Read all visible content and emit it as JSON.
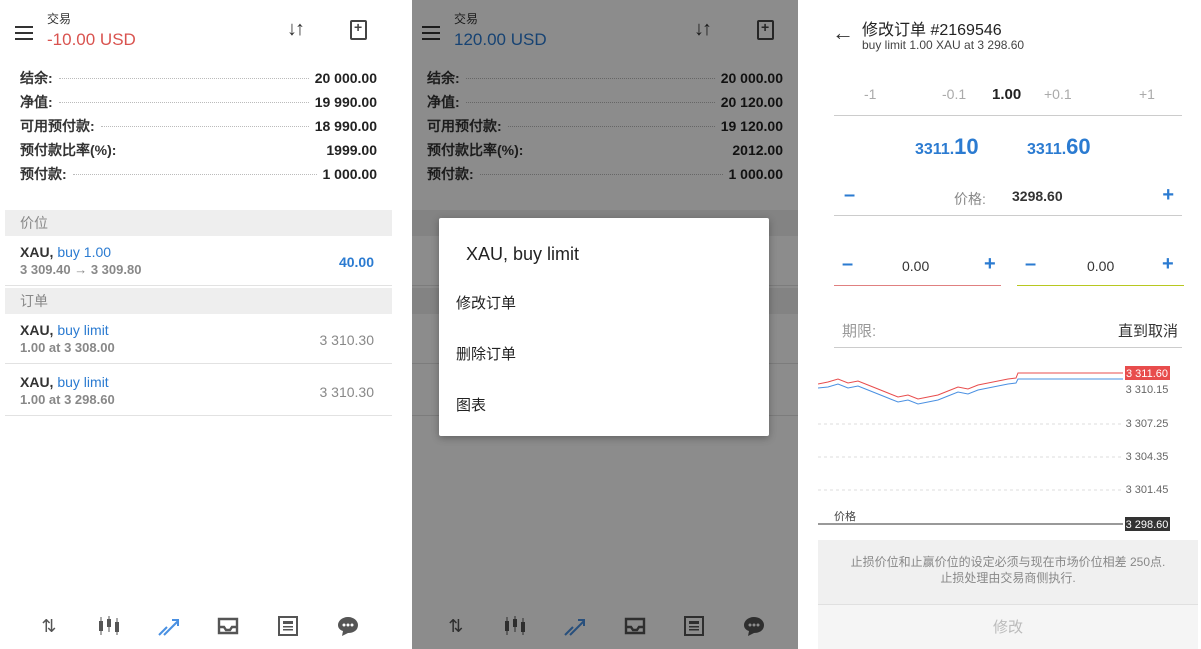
{
  "screens": [
    {
      "header": {
        "title": "交易",
        "balance": "-10.00 USD",
        "balance_color": "#d9534f"
      },
      "summary": [
        {
          "label": "结余:",
          "value": "20 000.00"
        },
        {
          "label": "净值:",
          "value": "19 990.00"
        },
        {
          "label": "可用预付款:",
          "value": "18 990.00"
        },
        {
          "label": "预付款比率(%):",
          "value": "1999.00"
        },
        {
          "label": "预付款:",
          "value": "1 000.00"
        }
      ],
      "positions_header": "价位",
      "positions": [
        {
          "symbol": "XAU,",
          "side": "buy 1.00",
          "detail": "3 309.40 → 3 309.80",
          "value": "40.00"
        }
      ],
      "orders_header": "订单",
      "orders": [
        {
          "symbol": "XAU,",
          "side": "buy limit",
          "detail": "1.00 at 3 308.00",
          "value": "3 310.30"
        },
        {
          "symbol": "XAU,",
          "side": "buy limit",
          "detail": "1.00 at 3 298.60",
          "value": "3 310.30"
        }
      ]
    },
    {
      "header": {
        "title": "交易",
        "balance": "120.00 USD",
        "balance_color": "#2b7bd1"
      },
      "summary": [
        {
          "label": "结余:",
          "value": "20 000.00"
        },
        {
          "label": "净值:",
          "value": "20 120.00"
        },
        {
          "label": "可用预付款:",
          "value": "19 120.00"
        },
        {
          "label": "预付款比率(%):",
          "value": "2012.00"
        },
        {
          "label": "预付款:",
          "value": "1 000.00"
        }
      ],
      "dialog": {
        "title": "XAU, buy limit",
        "options": [
          "修改订单",
          "删除订单",
          "图表"
        ]
      }
    },
    {
      "title": "修改订单 #2169546",
      "subtitle": "buy limit 1.00 XAU at 3 298.60",
      "volume": {
        "m1": "-1",
        "m01": "-0.1",
        "value": "1.00",
        "p01": "+0.1",
        "p1": "+1"
      },
      "bid": {
        "prefix": "3311.",
        "big": "10"
      },
      "ask": {
        "prefix": "3311.",
        "big": "60"
      },
      "price_label": "价格:",
      "price_value": "3298.60",
      "sl_value": "0.00",
      "tp_value": "0.00",
      "expiry_label": "期限:",
      "expiry_value": "直到取消",
      "chart_labels": [
        "3 311.60",
        "3 310.15",
        "3 307.25",
        "3 304.35",
        "3 301.45",
        "3 298.60"
      ],
      "chart_price_label": "价格",
      "note_line1": "止损价位和止赢价位的设定必须与现在市场价位相差 250点.",
      "note_line2": "止损处理由交易商侧执行.",
      "modify_button": "修改"
    }
  ],
  "nav_icons": [
    "quotes-icon",
    "chart-candles-icon",
    "trade-icon",
    "history-inbox-icon",
    "news-icon",
    "chat-icon"
  ],
  "colors": {
    "accent": "#2b7bd1",
    "loss": "#d9534f",
    "ask_line": "#e84c4c",
    "bid_line": "#4a90e2"
  }
}
